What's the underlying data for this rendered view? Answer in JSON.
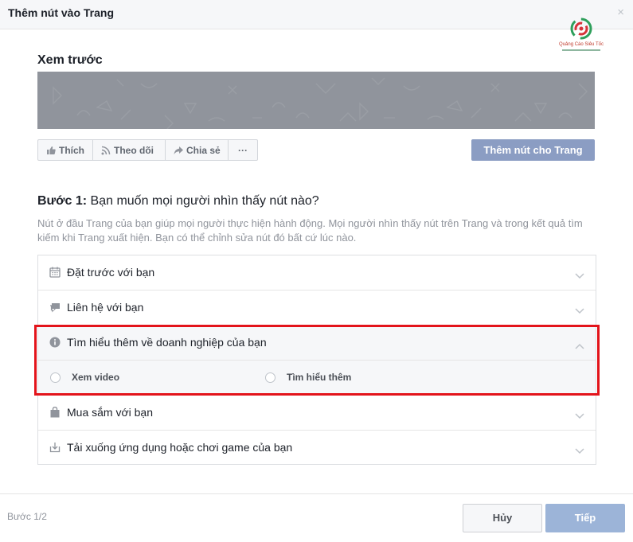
{
  "dialog": {
    "title": "Thêm nút vào Trang",
    "close_glyph": "×"
  },
  "logo": {
    "text": "Quảng Cáo Siêu Tốc",
    "icon": "brand-logo-icon"
  },
  "preview": {
    "label": "Xem trước",
    "actions": [
      {
        "label": "Thích",
        "icon": "thumbs-up-icon"
      },
      {
        "label": "Theo dõi",
        "icon": "rss-icon"
      },
      {
        "label": "Chia sẻ",
        "icon": "share-arrow-icon"
      },
      {
        "label": "···",
        "icon": "more-icon"
      }
    ],
    "add_button": "Thêm nút cho Trang"
  },
  "step": {
    "prefix": "Bước 1:",
    "question": " Bạn muốn mọi người nhìn thấy nút nào?",
    "description": "Nút ở đầu Trang của bạn giúp mọi người thực hiện hành động. Mọi người nhìn thấy nút trên Trang và trong kết quả tìm kiếm khi Trang xuất hiện. Bạn có thể chỉnh sửa nút đó bất cứ lúc nào."
  },
  "options": [
    {
      "label": "Đặt trước với bạn",
      "icon": "calendar-icon",
      "expanded": false
    },
    {
      "label": "Liên hệ với bạn",
      "icon": "chat-bubbles-icon",
      "expanded": false
    },
    {
      "label": "Tìm hiểu thêm về doanh nghiệp của bạn",
      "icon": "info-icon",
      "expanded": true
    },
    {
      "label": "Mua sắm với bạn",
      "icon": "shopping-bag-icon",
      "expanded": false
    },
    {
      "label": "Tải xuống ứng dụng hoặc chơi game của bạn",
      "icon": "download-icon",
      "expanded": false
    }
  ],
  "sub_options": [
    {
      "label": "Xem video",
      "selected": false
    },
    {
      "label": "Tìm hiểu thêm",
      "selected": false
    }
  ],
  "footer": {
    "step_count": "Bước 1/2",
    "cancel": "Hủy",
    "next": "Tiếp"
  },
  "colors": {
    "primary_disabled": "#9cb4d8",
    "highlight": "#e3141b"
  }
}
